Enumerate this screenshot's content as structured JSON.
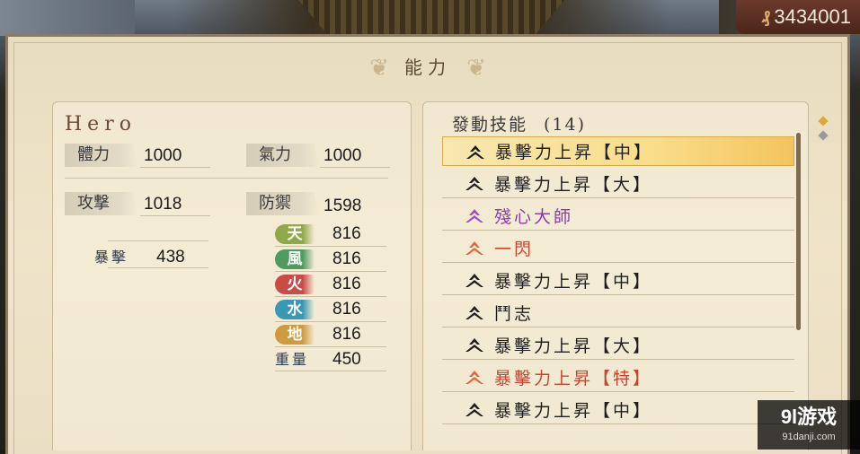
{
  "money": {
    "value": "3434001",
    "icon": "coin-icon"
  },
  "panel": {
    "title": "能力"
  },
  "hero": {
    "name": "Hero",
    "stats": {
      "stamina_label": "體力",
      "stamina_value": "1000",
      "ki_label": "氣力",
      "ki_value": "1000",
      "attack_label": "攻撃",
      "attack_value": "1018",
      "defense_label": "防禦",
      "defense_value": "1598",
      "crit_label": "暴擊",
      "crit_value": "438",
      "weight_label": "重量",
      "weight_value": "450"
    },
    "elements": [
      {
        "label": "天",
        "value": "816",
        "color": "#8fa84a"
      },
      {
        "label": "風",
        "value": "816",
        "color": "#4f9a5f"
      },
      {
        "label": "火",
        "value": "816",
        "color": "#c94b48"
      },
      {
        "label": "水",
        "value": "816",
        "color": "#3a98b5"
      },
      {
        "label": "地",
        "value": "816",
        "color": "#d09a3e"
      }
    ]
  },
  "skills": {
    "header": "發動技能",
    "count": "(14)",
    "items": [
      {
        "name": "暴擊力上昇【中】",
        "color": "#1e1e1e",
        "icon_color": "#1e1e1e",
        "selected": true
      },
      {
        "name": "暴擊力上昇【大】",
        "color": "#1e1e1e",
        "icon_color": "#1e1e1e"
      },
      {
        "name": "殘心大師",
        "color": "#8b3da6",
        "icon_color": "#9a4fc0"
      },
      {
        "name": "一閃",
        "color": "#c8442e",
        "icon_color": "#e0673e"
      },
      {
        "name": "暴擊力上昇【中】",
        "color": "#1e1e1e",
        "icon_color": "#1e1e1e"
      },
      {
        "name": "鬥志",
        "color": "#1e1e1e",
        "icon_color": "#1e1e1e"
      },
      {
        "name": "暴擊力上昇【大】",
        "color": "#1e1e1e",
        "icon_color": "#1e1e1e"
      },
      {
        "name": "暴擊力上昇【特】",
        "color": "#c8442e",
        "icon_color": "#e0673e"
      },
      {
        "name": "暴擊力上昇【中】",
        "color": "#1e1e1e",
        "icon_color": "#1e1e1e"
      }
    ]
  },
  "watermark": {
    "main": "9l游戏",
    "sub": "91danji.com"
  }
}
